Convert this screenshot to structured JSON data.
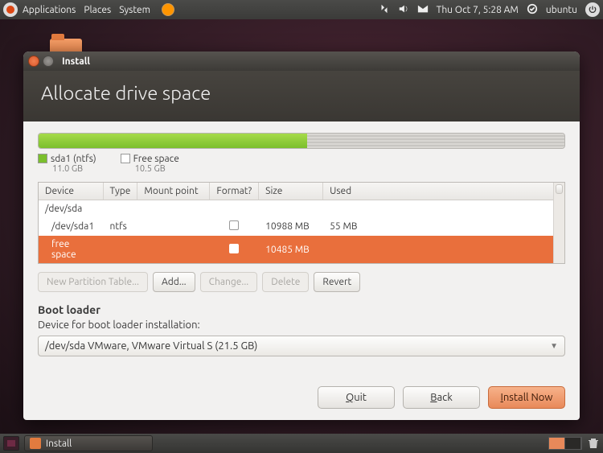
{
  "panel": {
    "menus": [
      "Applications",
      "Places",
      "System"
    ],
    "datetime": "Thu Oct  7,  5:28 AM",
    "user": "ubuntu"
  },
  "window": {
    "title": "Install",
    "header": "Allocate drive space"
  },
  "usage": {
    "items": [
      {
        "label": "sda1 (ntfs)",
        "size": "11.0 GB",
        "color": "#7bbf2d",
        "pct": 51
      },
      {
        "label": "Free space",
        "size": "10.5 GB",
        "color": "#ffffff",
        "pct": 49
      }
    ]
  },
  "columns": [
    "Device",
    "Type",
    "Mount point",
    "Format?",
    "Size",
    "Used"
  ],
  "rows": [
    {
      "device": "/dev/sda",
      "type": "",
      "mount": "",
      "format": null,
      "size": "",
      "used": "",
      "indent": 0,
      "selected": false
    },
    {
      "device": "/dev/sda1",
      "type": "ntfs",
      "mount": "",
      "format": false,
      "size": "10988 MB",
      "used": "55 MB",
      "indent": 1,
      "selected": false
    },
    {
      "device": "free space",
      "type": "",
      "mount": "",
      "format": false,
      "size": "10485 MB",
      "used": "",
      "indent": 1,
      "selected": true
    }
  ],
  "buttons": {
    "new_table": "New Partition Table...",
    "add": "Add...",
    "change": "Change...",
    "delete": "Delete",
    "revert": "Revert"
  },
  "bootloader": {
    "heading": "Boot loader",
    "label": "Device for boot loader installation:",
    "value": "/dev/sda VMware, VMware Virtual S (21.5 GB)"
  },
  "footer": {
    "quit": "Quit",
    "back": "Back",
    "install": "Install Now"
  },
  "taskbar": {
    "task1": "Install"
  }
}
